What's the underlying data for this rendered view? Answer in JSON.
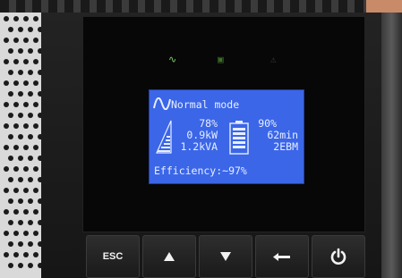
{
  "indicators": {
    "ac_icon": "ac-power-icon",
    "battery_icon": "battery-icon",
    "alarm_icon": "warning-icon",
    "ac_color": "#7cd36b"
  },
  "lcd": {
    "mode": "Normal mode",
    "load_percent": "78%",
    "power_kw": "0.9kW",
    "power_kva": "1.2kVA",
    "battery_percent": "90%",
    "runtime": "62min",
    "ebm": "2EBM",
    "efficiency": "Efficiency:~97%",
    "background": "#3b66e8"
  },
  "keys": {
    "esc": "ESC",
    "up_icon": "up-arrow-icon",
    "down_icon": "down-arrow-icon",
    "enter_icon": "enter-icon",
    "power_icon": "power-icon"
  }
}
